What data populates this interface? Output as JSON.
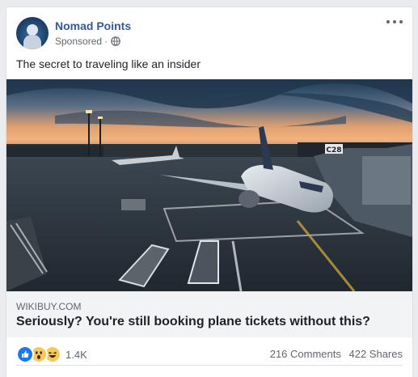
{
  "post": {
    "page_name": "Nomad Points",
    "sponsored": "Sponsored",
    "separator": "·",
    "text": "The secret to traveling like an insider"
  },
  "link": {
    "domain": "WIKIBUY.COM",
    "headline": "Seriously? You're still booking plane tickets without this?"
  },
  "stats": {
    "reaction_count": "1.4K",
    "comments": "216 Comments",
    "shares": "422 Shares"
  },
  "image": {
    "aircraft_label": "C28"
  },
  "icons": {
    "more": "more-options-icon",
    "audience": "globe-icon",
    "reactions": [
      "like-reaction-icon",
      "wow-reaction-icon",
      "haha-reaction-icon"
    ]
  },
  "colors": {
    "page_link": "#365899",
    "like_blue": "#1877f2",
    "reaction_yellow": "#f7c95c",
    "background": "#e9ebee"
  }
}
